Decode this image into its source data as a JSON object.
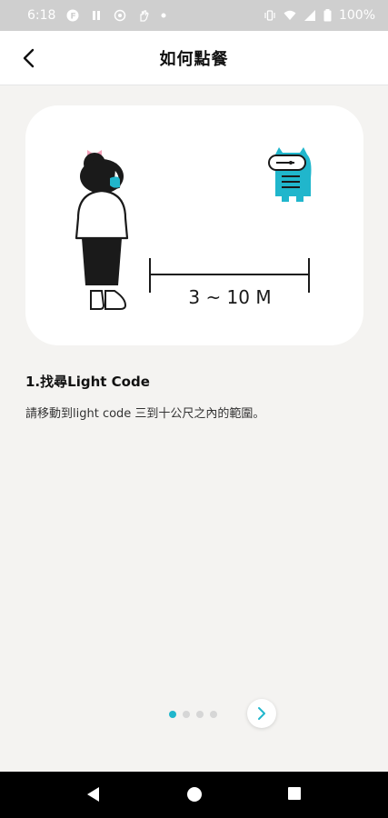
{
  "status_bar": {
    "time": "6:18",
    "battery": "100%",
    "icons": [
      "app-f-icon",
      "pause-icon",
      "target-icon",
      "hand-icon",
      "dot-icon",
      "vibrate-icon",
      "wifi-icon",
      "signal-icon",
      "battery-icon"
    ]
  },
  "header": {
    "title": "如何點餐",
    "back_icon": "chevron-left-icon"
  },
  "illustration": {
    "distance_label": "3 ~ 10 M",
    "accent_color": "#20b6cc",
    "bow_color": "#f3a0b8"
  },
  "step": {
    "title": "1.找尋Light Code",
    "description": "請移動到light code 三到十公尺之內的範圍。"
  },
  "pager": {
    "total_pages": 4,
    "current_page": 1,
    "next_icon": "chevron-right-icon"
  },
  "nav_bar": {
    "items": [
      "back-triangle-icon",
      "home-circle-icon",
      "recents-square-icon"
    ]
  }
}
